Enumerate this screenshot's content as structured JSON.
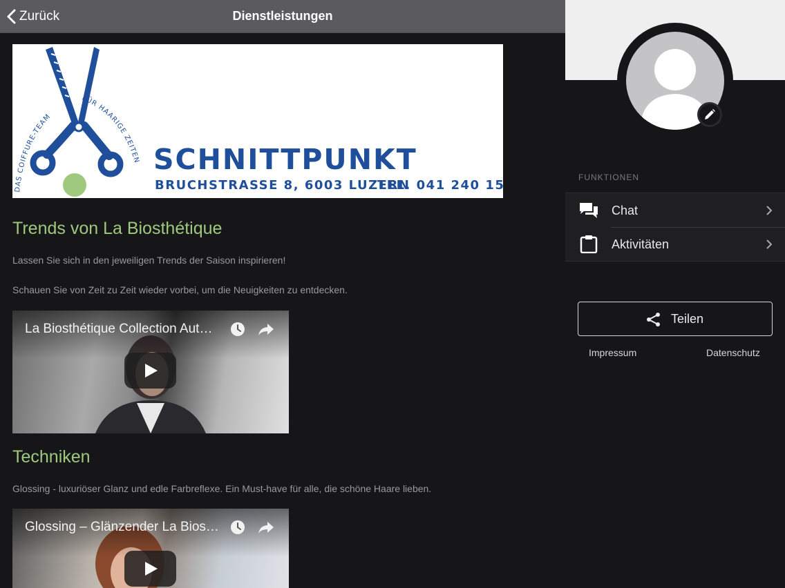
{
  "topbar": {
    "back_label": "Zurück",
    "title": "Dienstleistungen"
  },
  "banner": {
    "arc_text_left": "DAS COIFFURE-TEAM",
    "arc_text_right": "FÜR HAARIGE ZEITEN",
    "brand_name": "SCHNITTPUNKT",
    "address": "BRUCHSTRASSE 8, 6003 LUZERN",
    "tel": "TEL. 041 240 15 45",
    "brand_color": "#1f4e9b",
    "dot_color": "#9ec97f"
  },
  "sections": {
    "trends": {
      "title": "Trends von La Biosthétique",
      "p1": "Lassen Sie sich in den jeweiligen Trends der Saison inspirieren!",
      "p2": "Schauen Sie von Zeit zu Zeit wieder vorbei, um die Neuigkeiten zu entdecken.",
      "video_title": "La Biosthétique Collection Aut…"
    },
    "techniken": {
      "title": "Techniken",
      "p1": "Glossing - luxuriöser Glanz und edle Farbreflexe. Ein Must-have für alle, die schöne Haare lieben.",
      "video_title": "Glossing – Glänzender La Bios…"
    }
  },
  "sidebar": {
    "functions_label": "FUNKTIONEN",
    "menu": [
      {
        "label": "Chat",
        "icon": "chat-icon"
      },
      {
        "label": "Aktivitäten",
        "icon": "clipboard-icon"
      }
    ],
    "share_label": "Teilen",
    "impressum": "Impressum",
    "datenschutz": "Datenschutz"
  },
  "colors": {
    "accent_green": "#9ec97f",
    "topbar": "#5b5b5d",
    "background": "#161618"
  }
}
